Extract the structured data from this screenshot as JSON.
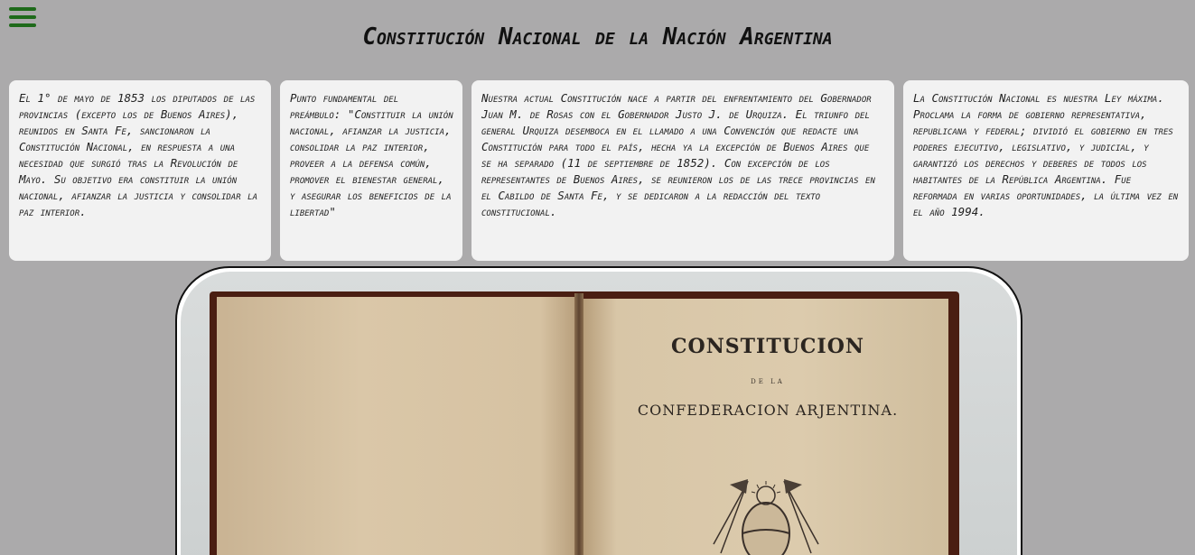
{
  "page": {
    "title": "Constitución Nacional de la Nación Argentina"
  },
  "menu": {
    "icon": "hamburger-menu-icon"
  },
  "cards": [
    {
      "text": "El 1° de mayo de 1853 los diputados de las provincias (excepto los de Buenos Aires), reunidos en Santa Fe, sancionaron la Constitución Nacional, en respuesta a una necesidad que surgió tras la Revolución de Mayo. Su objetivo era constituir la unión nacional, afianzar la justicia y consolidar la paz interior."
    },
    {
      "text": "Punto fundamental del preámbulo: \"Constituir la unión nacional, afianzar la justicia, consolidar la paz interior, proveer a la defensa común, promover el bienestar general, y asegurar los beneficios de la libertad\""
    },
    {
      "text": "Nuestra actual Constitución nace a partir del enfrentamiento del Gobernador Juan M. de Rosas con el Gobernador Justo J. de Urquiza. El triunfo del general Urquiza desemboca en el llamado a una Convención que redacte una Constitución para todo el país, hecha ya la excepción de Buenos Aires que se ha separado (11 de septiembre de 1852). Con excepción de los representantes de Buenos Aires, se reunieron los de las trece provincias en el Cabildo de Santa Fe, y se dedicaron a la redacción del texto constitucional."
    },
    {
      "text": "La Constitución Nacional es nuestra Ley máxima. Proclama la forma de gobierno representativa, republicana y federal; dividió el gobierno en tres poderes ejecutivo, legislativo, y judicial, y garantizó los derechos y deberes de todos los habitantes de la República Argentina. Fue reformada en varias oportunidades, la última vez en el año 1994."
    }
  ],
  "image": {
    "book_title": "CONSTITUCION",
    "book_de": "DE LA",
    "book_subtitle": "CONFEDERACION ARJENTINA."
  },
  "colors": {
    "background": "#abaaab",
    "menu_icon": "#1e6a1a",
    "card": "#f2f2f2"
  }
}
